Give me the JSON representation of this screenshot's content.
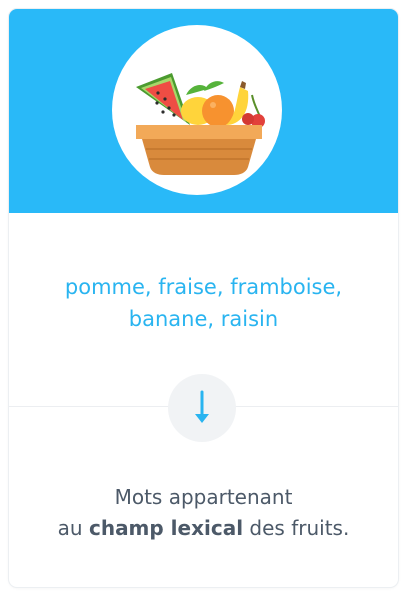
{
  "illustration": {
    "icon": "fruit-basket-icon",
    "background_color": "#29b9f8"
  },
  "words": {
    "line1": "pomme, fraise, framboise,",
    "line2": "banane, raisin",
    "color": "#29b4f0"
  },
  "arrow": {
    "icon": "arrow-down-icon",
    "color": "#29b4f0"
  },
  "description": {
    "line1": "Mots appartenant",
    "line2_prefix": "au ",
    "line2_bold": "champ lexical",
    "line2_suffix": " des fruits."
  }
}
